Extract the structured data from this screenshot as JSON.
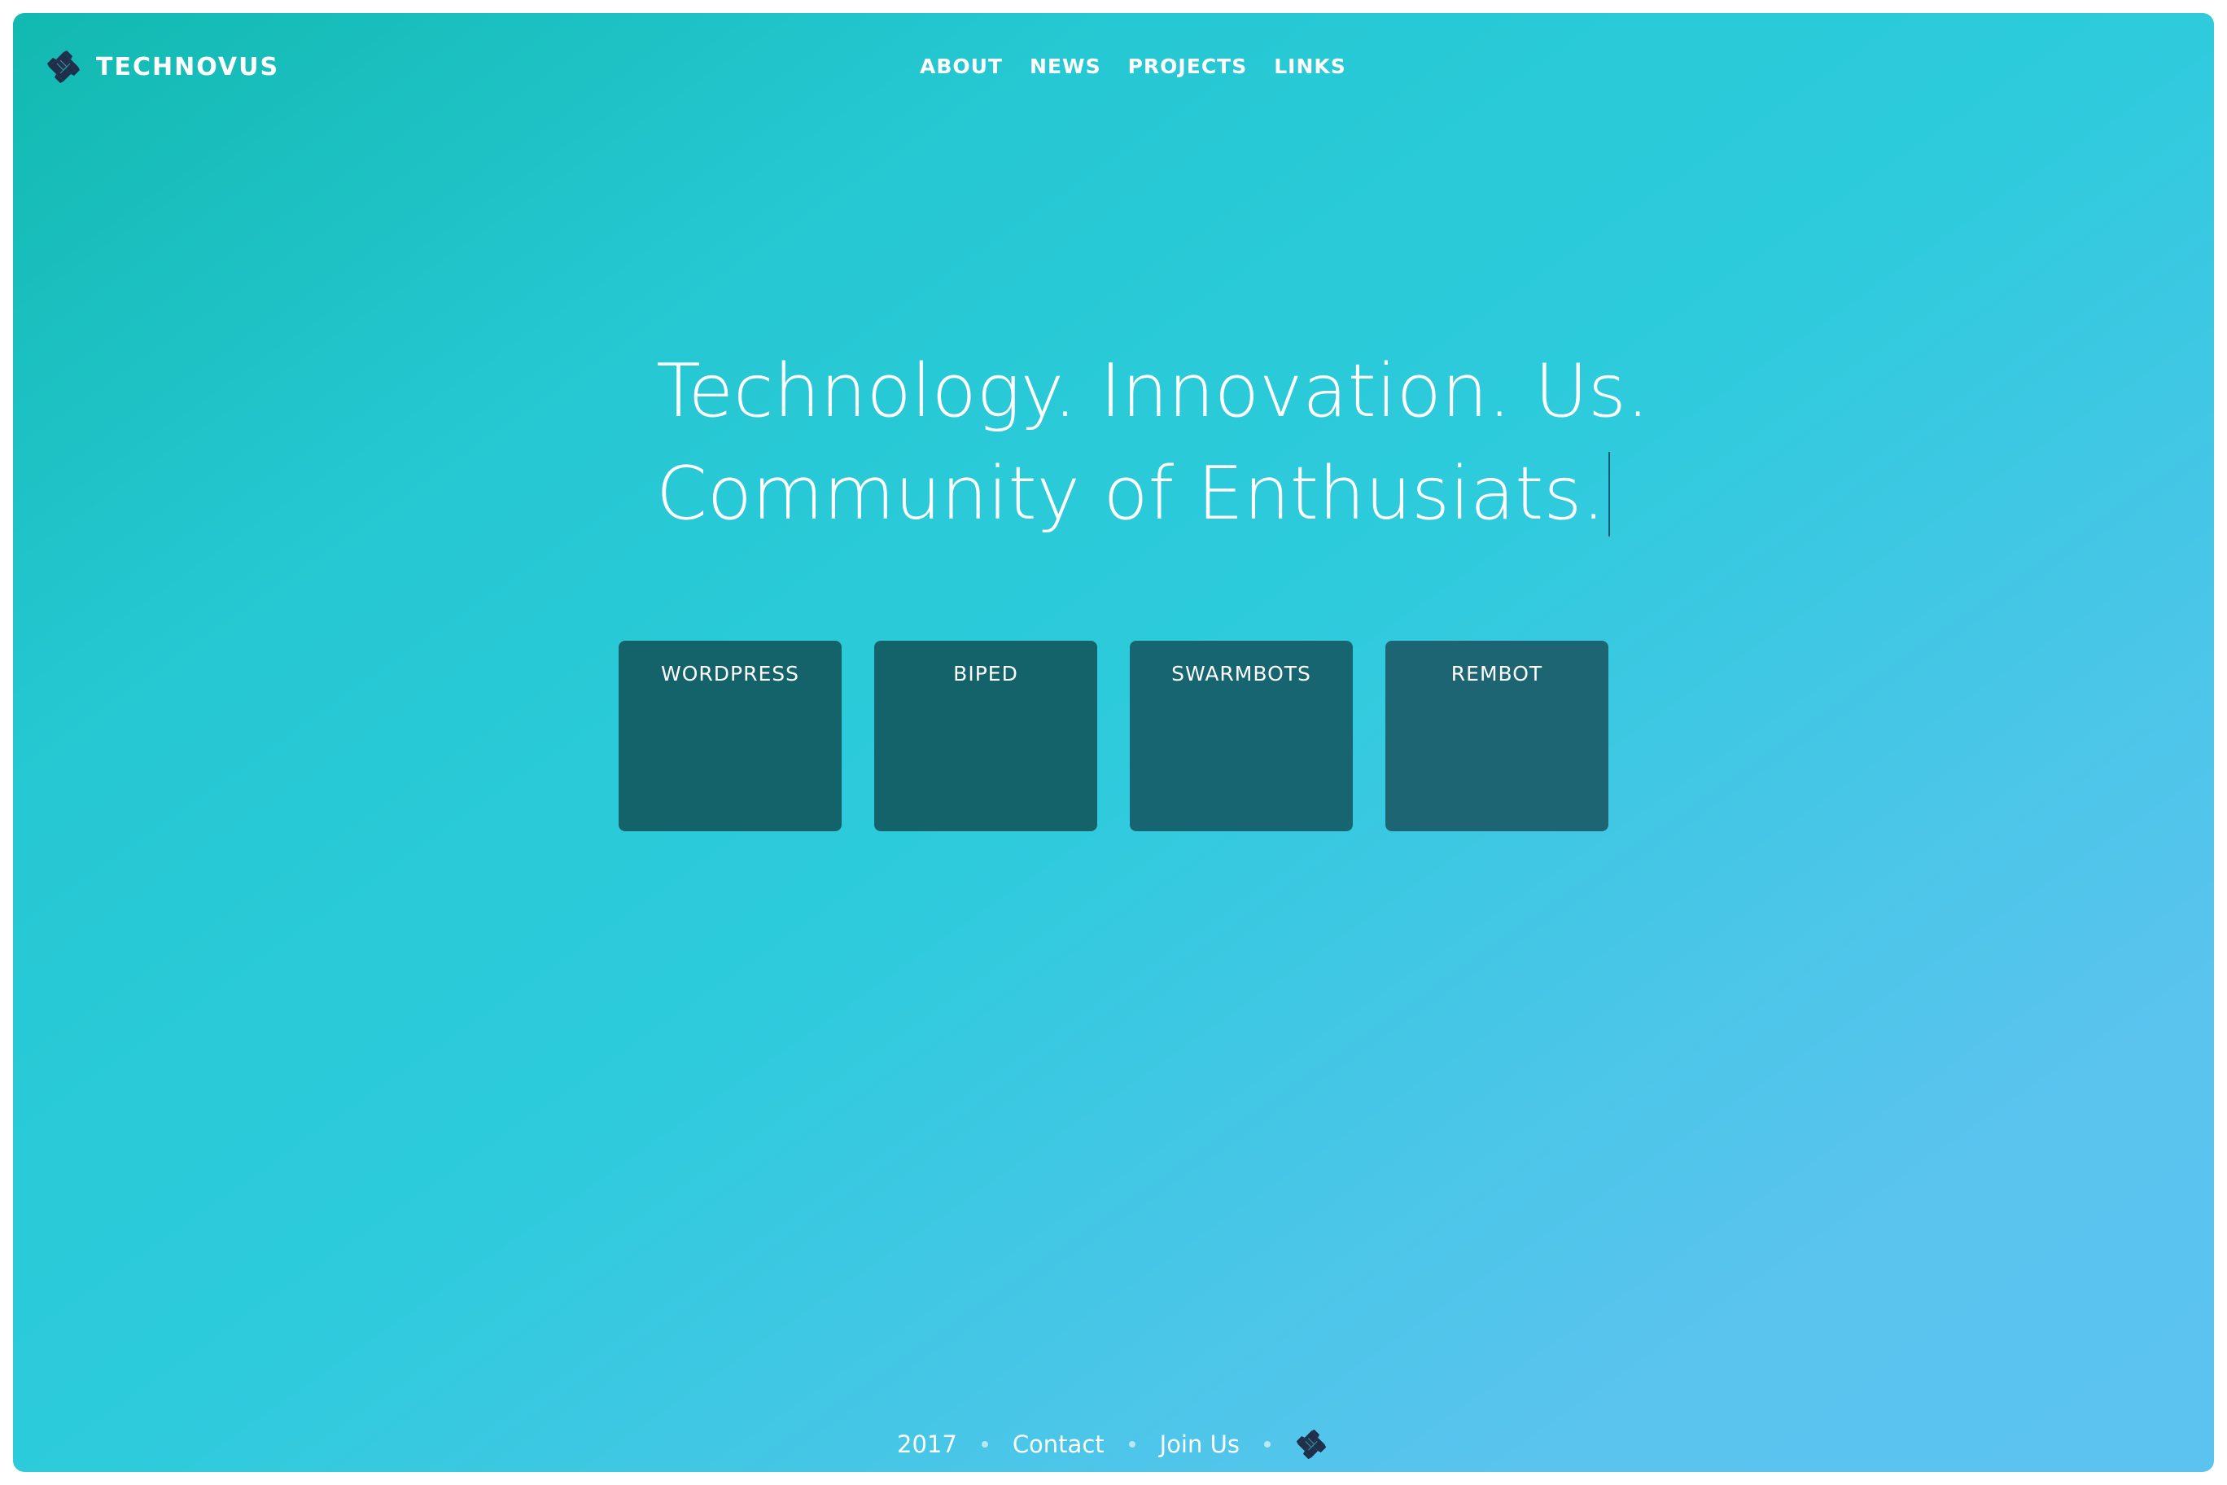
{
  "header": {
    "brand": "TECHNOVUS",
    "logo_icon": "technovus-logo-icon",
    "nav": [
      {
        "label": "ABOUT"
      },
      {
        "label": "NEWS"
      },
      {
        "label": "PROJECTS"
      },
      {
        "label": "LINKS"
      }
    ]
  },
  "hero": {
    "line1": "Technology. Innovation. Us.",
    "line2": "Community of Enthusiats."
  },
  "projects": [
    {
      "label": "WORDPRESS"
    },
    {
      "label": "BIPED"
    },
    {
      "label": "SWARMBOTS"
    },
    {
      "label": "REMBOT"
    }
  ],
  "footer": {
    "year": "2017",
    "contact": "Contact",
    "join": "Join Us",
    "icon": "technovus-logo-icon"
  },
  "colors": {
    "gradient_start": "#12b9b0",
    "gradient_mid": "#2dcbdc",
    "gradient_end": "#5cc2ef",
    "card": "#15636a",
    "logo": "#1f2f4a"
  }
}
